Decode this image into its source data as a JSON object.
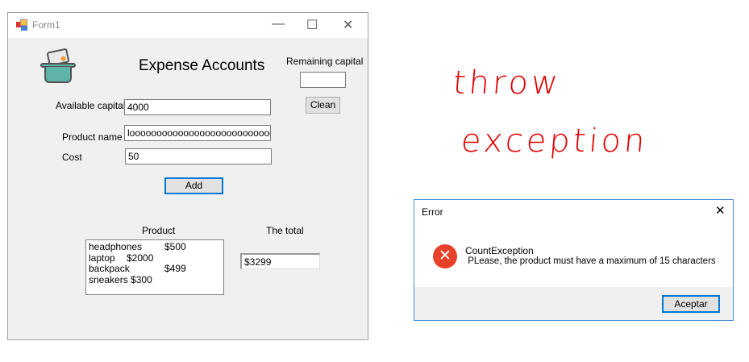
{
  "form": {
    "title": "Form1",
    "heading": "Expense Accounts",
    "remaining_label": "Remaining capital",
    "remaining_value": "",
    "clean_label": "Clean",
    "available_label": "Available capital",
    "available_value": "4000",
    "product_label": "Product name",
    "product_value": "loooooooooooooooooooooooooool",
    "cost_label": "Cost",
    "cost_value": "50",
    "add_label": "Add",
    "product_list_label": "Product",
    "total_label": "The total",
    "total_value": "$3299",
    "products": [
      {
        "name": "headphones",
        "price": "$500"
      },
      {
        "name": "laptop",
        "price": "$2000"
      },
      {
        "name": "backpack",
        "price": "$499"
      },
      {
        "name": "sneakers",
        "price": "$300"
      }
    ]
  },
  "annotation": {
    "line1": "throw",
    "line2": "exception",
    "color": "#e00000"
  },
  "dialog": {
    "title": "Error",
    "heading": "CountException",
    "message": " PLease, the product must have a maximum of 15 characters",
    "ok_label": "Aceptar",
    "icon": "error-icon"
  }
}
